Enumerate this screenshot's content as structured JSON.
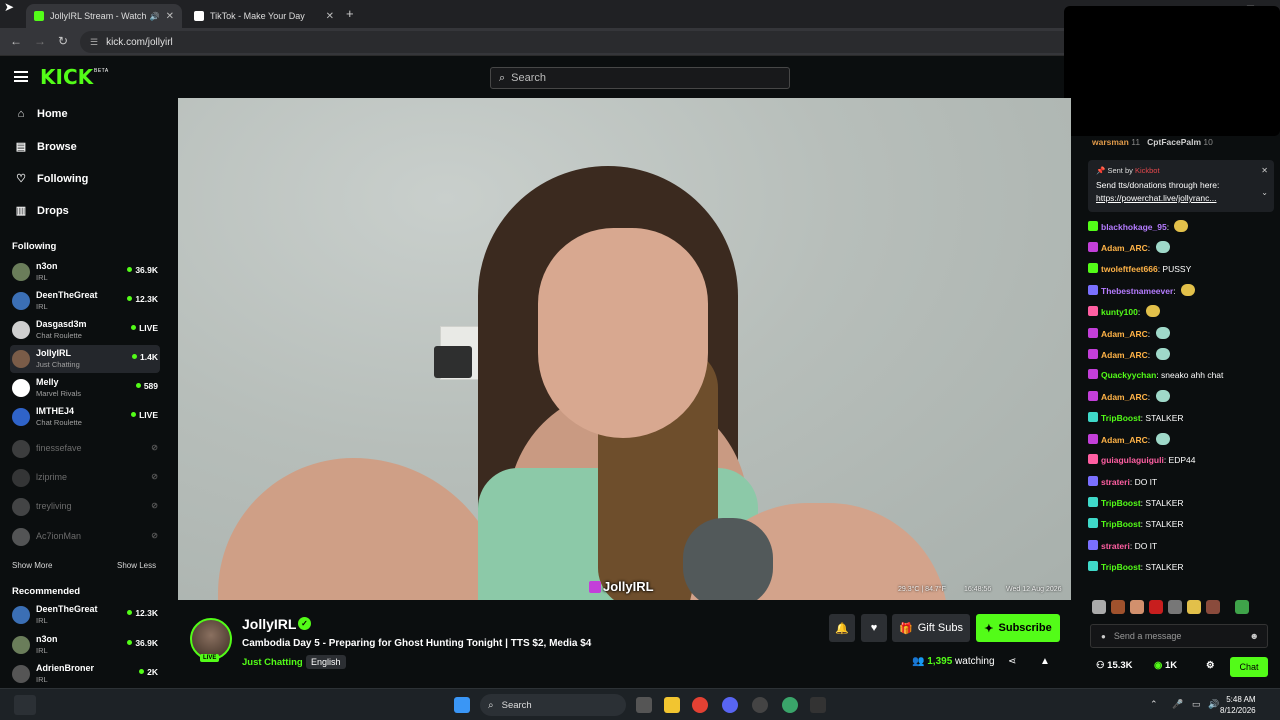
{
  "browser": {
    "tabs": [
      {
        "title": "JollyIRL Stream - Watch Live",
        "favicon_color": "#53fc18"
      },
      {
        "title": "TikTok - Make Your Day",
        "favicon_color": "#ffffff"
      }
    ],
    "new_tab": "+",
    "url": "kick.com/jollyirl"
  },
  "header": {
    "logo": "KICK",
    "logo_badge": "BETA",
    "search_placeholder": "Search"
  },
  "sidebar": {
    "nav": [
      {
        "label": "Home",
        "icon": "home-icon"
      },
      {
        "label": "Browse",
        "icon": "browse-icon"
      },
      {
        "label": "Following",
        "icon": "heart-icon"
      },
      {
        "label": "Drops",
        "icon": "drops-icon"
      }
    ],
    "following_title": "Following",
    "following": [
      {
        "name": "n3on",
        "category": "IRL",
        "viewers": "36.9K",
        "live": true,
        "avatar_color": "#6a7d5a"
      },
      {
        "name": "DeenTheGreat",
        "category": "IRL",
        "viewers": "12.3K",
        "live": true,
        "avatar_color": "#3b6fb5"
      },
      {
        "name": "Dasgasd3m",
        "category": "Chat Roulette",
        "viewers": "LIVE",
        "live": true,
        "avatar_color": "#cfcfcf"
      },
      {
        "name": "JollyIRL",
        "category": "Just Chatting",
        "viewers": "1.4K",
        "live": true,
        "avatar_color": "#7a5c48"
      },
      {
        "name": "Melly",
        "category": "Marvel Rivals",
        "viewers": "589",
        "live": true,
        "avatar_color": "#ffffff"
      },
      {
        "name": "IMTHEJ4",
        "category": "Chat Roulette",
        "viewers": "LIVE",
        "live": true,
        "avatar_color": "#2f63c9"
      },
      {
        "name": "finessefave",
        "category": "",
        "viewers": "",
        "live": false,
        "avatar_color": "#777777"
      },
      {
        "name": "lziprime",
        "category": "",
        "viewers": "",
        "live": false,
        "avatar_color": "#666666"
      },
      {
        "name": "treyliving",
        "category": "",
        "viewers": "",
        "live": false,
        "avatar_color": "#888888"
      },
      {
        "name": "Ac7ionMan",
        "category": "",
        "viewers": "",
        "live": false,
        "avatar_color": "#aaaaaa"
      }
    ],
    "show_more": "Show More",
    "show_less": "Show Less",
    "recommended_title": "Recommended",
    "recommended": [
      {
        "name": "DeenTheGreat",
        "category": "IRL",
        "viewers": "12.3K",
        "avatar_color": "#3b6fb5"
      },
      {
        "name": "n3on",
        "category": "IRL",
        "viewers": "36.9K",
        "avatar_color": "#6a7d5a"
      },
      {
        "name": "AdrienBroner",
        "category": "IRL",
        "viewers": "2K",
        "avatar_color": "#555555"
      }
    ]
  },
  "video": {
    "watermark": "JollyIRL",
    "temperature": "29.3°C | 84.7°F",
    "time": "16:48:56",
    "date": "Wed 12 Aug 2026"
  },
  "stream": {
    "streamer": "JollyIRL",
    "title": "Cambodia Day 5 - Preparing for Ghost Hunting Tonight | TTS $2, Media $4",
    "category": "Just Chatting",
    "language": "English",
    "live_label": "LIVE",
    "gift_subs": "Gift Subs",
    "subscribe": "Subscribe",
    "viewers": "1,395",
    "watching_label": "watching"
  },
  "chat": {
    "top_gifters": [
      {
        "name": "warsman",
        "count": "11"
      },
      {
        "name": "CptFacePalm",
        "count": "10"
      }
    ],
    "pinned": {
      "sent_by_label": "Sent by",
      "sender": "Kickbot",
      "message": "Send tts/donations through here:",
      "link": "https://powerchat.live/jollyranc..."
    },
    "messages": [
      {
        "user": "blackhokage_95",
        "text": "",
        "color": "#b57cff",
        "badge": "#53fc18"
      },
      {
        "user": "Adam_ARC",
        "text": "",
        "color": "#ffb347",
        "badge": "#c33fd9"
      },
      {
        "user": "twoleftfeet666",
        "text": "PUSSY",
        "color": "#ffb347",
        "badge": "#53fc18"
      },
      {
        "user": "Thebestnameever",
        "text": "",
        "color": "#b57cff",
        "badge": "#7a70ff"
      },
      {
        "user": "kunty100",
        "text": "",
        "color": "#53fc18",
        "badge": "#ff5fa2"
      },
      {
        "user": "Adam_ARC",
        "text": "",
        "color": "#ffb347",
        "badge": "#c33fd9"
      },
      {
        "user": "Adam_ARC",
        "text": "",
        "color": "#ffb347",
        "badge": "#c33fd9"
      },
      {
        "user": "Quackyychan",
        "text": "sneako ahh chat",
        "color": "#53fc18",
        "badge": "#c33fd9"
      },
      {
        "user": "Adam_ARC",
        "text": "",
        "color": "#ffb347",
        "badge": "#c33fd9"
      },
      {
        "user": "TripBoost",
        "text": "STALKER",
        "color": "#53fc18",
        "badge": "#3fd9c9"
      },
      {
        "user": "Adam_ARC",
        "text": "",
        "color": "#ffb347",
        "badge": "#c33fd9"
      },
      {
        "user": "guiagulaguiguli",
        "text": "EDP44",
        "color": "#ff5fa2",
        "badge": "#ff5fa2"
      },
      {
        "user": "strateri",
        "text": "DO IT",
        "color": "#ff5fa2",
        "badge": "#7a70ff"
      },
      {
        "user": "TripBoost",
        "text": "STALKER",
        "color": "#53fc18",
        "badge": "#3fd9c9"
      },
      {
        "user": "TripBoost",
        "text": "STALKER",
        "color": "#53fc18",
        "badge": "#3fd9c9"
      },
      {
        "user": "strateri",
        "text": "DO IT",
        "color": "#ff5fa2",
        "badge": "#7a70ff"
      },
      {
        "user": "TripBoost",
        "text": "STALKER",
        "color": "#53fc18",
        "badge": "#3fd9c9"
      }
    ],
    "input_placeholder": "Send a message",
    "followers": "15.3K",
    "kicks": "1K",
    "chat_button": "Chat"
  },
  "taskbar": {
    "search": "Search",
    "time": "5:48 AM",
    "date": "8/12/2026"
  },
  "colors": {
    "accent": "#53fc18",
    "background": "#0b0e0f"
  }
}
